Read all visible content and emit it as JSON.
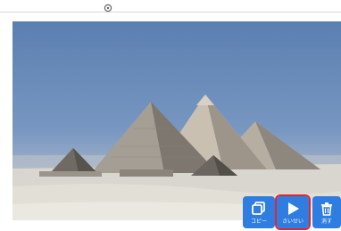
{
  "toolbar": {
    "buttons": [
      {
        "id": "copy",
        "label": "コピー",
        "icon": "copy-icon"
      },
      {
        "id": "play",
        "label": "さいせい",
        "icon": "play-icon",
        "highlighted": true
      },
      {
        "id": "delete",
        "label": "消す",
        "icon": "trash-icon"
      }
    ]
  },
  "image": {
    "subject": "pyramids-photo"
  },
  "colors": {
    "button_bg": "#2f7de1",
    "highlight_border": "#e1262e",
    "sky": "#5a7fb1",
    "sand": "#d9d6cf"
  }
}
